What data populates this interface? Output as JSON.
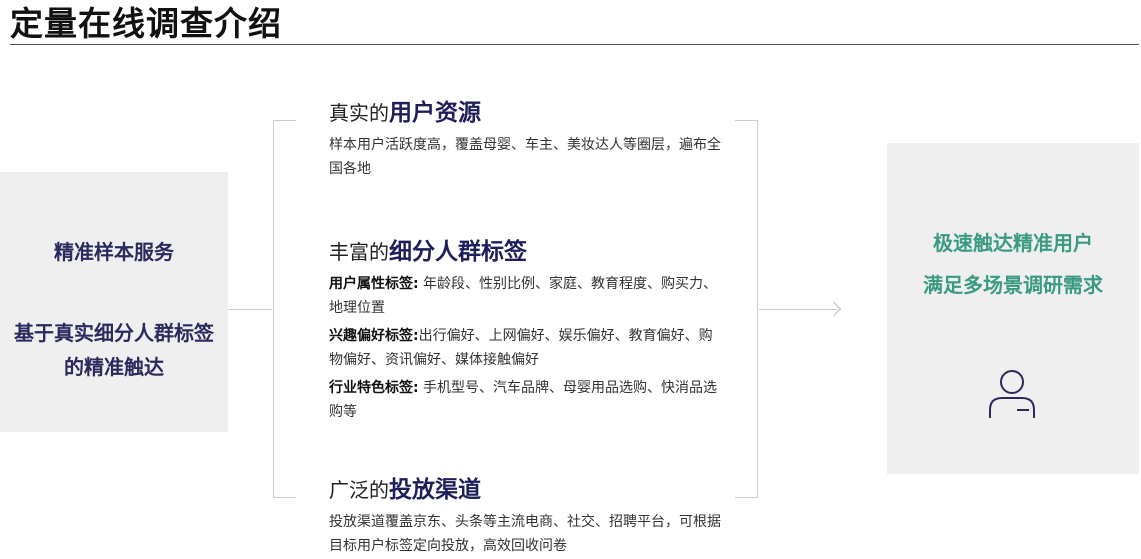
{
  "page": {
    "title": "定量在线调查介绍"
  },
  "left_panel": {
    "line1": "精准样本服务",
    "line2": "基于真实细分人群标签的精准触达"
  },
  "sections": [
    {
      "head_prefix": "真实的",
      "head_emphasis": "用户资源",
      "text": "样本用户活跃度高，覆盖母婴、车主、美妆达人等圈层，遍布全国各地"
    },
    {
      "head_prefix": "丰富的",
      "head_emphasis": "细分人群标签",
      "tags": [
        {
          "label": "用户属性标签:",
          "text": " 年龄段、性别比例、家庭、教育程度、购买力、地理位置"
        },
        {
          "label": "兴趣偏好标签:",
          "text": "出行偏好、上网偏好、娱乐偏好、教育偏好、购物偏好、资讯偏好、媒体接触偏好"
        },
        {
          "label": "行业特色标签:",
          "text": " 手机型号、汽车品牌、母婴用品选购、快消品选购等"
        }
      ]
    },
    {
      "head_prefix": "广泛的",
      "head_emphasis": "投放渠道",
      "text": "投放渠道覆盖京东、头条等主流电商、社交、招聘平台，可根据目标用户标签定向投放，高效回收问卷"
    }
  ],
  "right_panel": {
    "line1": "极速触达精准用户",
    "line2": "满足多场景调研需求",
    "icon": "user-icon"
  },
  "colors": {
    "navy": "#1e1e5a",
    "teal": "#3a9a82",
    "panel_bg": "#efefef"
  }
}
